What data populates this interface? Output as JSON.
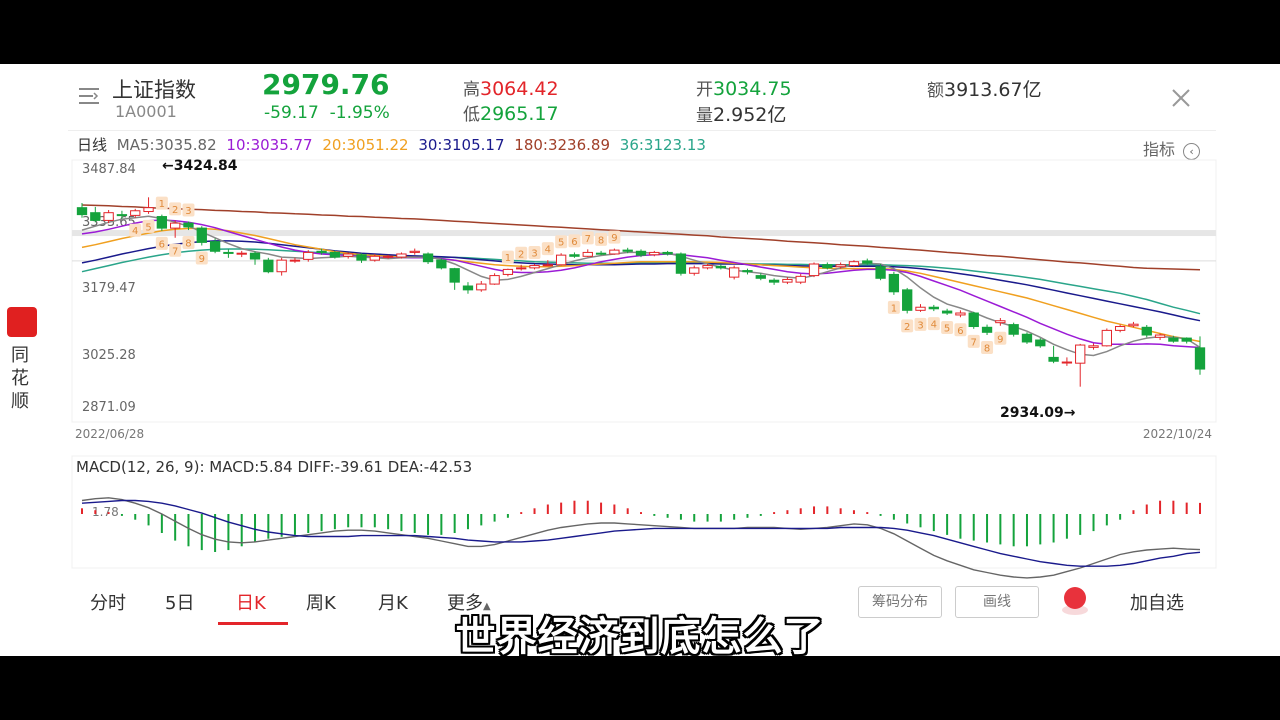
{
  "header": {
    "name": "上证指数",
    "code": "1A0001",
    "price": "2979.76",
    "change": "-59.17",
    "change_pct": "-1.95%",
    "high_label": "高",
    "high": "3064.42",
    "low_label": "低",
    "low": "2965.17",
    "open_label": "开",
    "open": "3034.75",
    "volume_label": "量",
    "volume": "2.952亿",
    "amount_label": "额",
    "amount": "3913.67亿"
  },
  "ma_row": {
    "period": "日线",
    "ma5": "MA5:3035.82",
    "ma10": "10:3035.77",
    "ma20": "20:3051.22",
    "ma30": "30:3105.17",
    "ma180": "180:3236.89",
    "ma36": "36:3123.13",
    "indicator_label": "指标"
  },
  "colors": {
    "up": "#e3252a",
    "down": "#14a33c",
    "ma5": "#888888",
    "ma10": "#9b1bd6",
    "ma20": "#f0a020",
    "ma30": "#1a1a8c",
    "ma180": "#a0402a",
    "ma36": "#2aa58a"
  },
  "price_axis": {
    "ticks": [
      "3487.84",
      "3333.65",
      "3179.47",
      "3025.28",
      "2871.09"
    ],
    "start_date": "2022/06/28",
    "end_date": "2022/10/24",
    "high_marker": "←3424.84",
    "low_marker": "2934.09→"
  },
  "macd": {
    "label": "MACD(12, 26, 9): MACD:5.84 DIFF:-39.61 DEA:-42.53",
    "tick": "1.78"
  },
  "sidebar": {
    "app_name": "同花顺"
  },
  "tabs": [
    "分时",
    "5日",
    "日K",
    "周K",
    "月K",
    "更多"
  ],
  "buttons": {
    "chips": "筹码分布",
    "draw": "画线",
    "add_fav": "加自选"
  },
  "subtitle": "世界经济到底怎么了",
  "chart_data": {
    "type": "candlestick",
    "title": "上证指数",
    "x_start": "2022/06/28",
    "x_end": "2022/10/24",
    "ylim": [
      2871.09,
      3487.84
    ],
    "y_ticks": [
      3487.84,
      3333.65,
      3179.47,
      3025.28,
      2871.09
    ],
    "annotations": [
      {
        "text": "←3424.84",
        "value": 3424.84
      },
      {
        "text": "2934.09→",
        "value": 2934.09
      }
    ],
    "candles": [
      [
        3398,
        3380,
        3410,
        3372
      ],
      [
        3385,
        3365,
        3400,
        3360
      ],
      [
        3365,
        3385,
        3392,
        3358
      ],
      [
        3380,
        3378,
        3390,
        3370
      ],
      [
        3378,
        3390,
        3395,
        3372
      ],
      [
        3388,
        3398,
        3424.84,
        3382
      ],
      [
        3375,
        3345,
        3380,
        3338
      ],
      [
        3345,
        3358,
        3365,
        3320
      ],
      [
        3358,
        3348,
        3362,
        3340
      ],
      [
        3345,
        3308,
        3350,
        3300
      ],
      [
        3310,
        3285,
        3318,
        3280
      ],
      [
        3282,
        3280,
        3290,
        3268
      ],
      [
        3280,
        3280,
        3286,
        3270
      ],
      [
        3280,
        3265,
        3285,
        3250
      ],
      [
        3262,
        3232,
        3268,
        3228
      ],
      [
        3232,
        3262,
        3268,
        3222
      ],
      [
        3262,
        3262,
        3268,
        3255
      ],
      [
        3264,
        3282,
        3288,
        3258
      ],
      [
        3285,
        3282,
        3292,
        3276
      ],
      [
        3282,
        3270,
        3286,
        3266
      ],
      [
        3272,
        3278,
        3282,
        3266
      ],
      [
        3276,
        3262,
        3280,
        3255
      ],
      [
        3262,
        3272,
        3278,
        3258
      ],
      [
        3272,
        3272,
        3276,
        3266
      ],
      [
        3270,
        3278,
        3282,
        3266
      ],
      [
        3282,
        3285,
        3292,
        3276
      ],
      [
        3278,
        3258,
        3282,
        3252
      ],
      [
        3262,
        3242,
        3266,
        3238
      ],
      [
        3240,
        3205,
        3242,
        3185
      ],
      [
        3195,
        3185,
        3205,
        3175
      ],
      [
        3185,
        3200,
        3208,
        3180
      ],
      [
        3200,
        3222,
        3228,
        3198
      ],
      [
        3225,
        3238,
        3240,
        3220
      ],
      [
        3240,
        3242,
        3250,
        3235
      ],
      [
        3242,
        3248,
        3252,
        3238
      ],
      [
        3250,
        3250,
        3262,
        3248
      ],
      [
        3250,
        3275,
        3280,
        3248
      ],
      [
        3276,
        3272,
        3282,
        3268
      ],
      [
        3272,
        3282,
        3290,
        3270
      ],
      [
        3280,
        3278,
        3286,
        3275
      ],
      [
        3278,
        3288,
        3292,
        3276
      ],
      [
        3288,
        3285,
        3294,
        3280
      ],
      [
        3285,
        3275,
        3290,
        3270
      ],
      [
        3276,
        3282,
        3286,
        3272
      ],
      [
        3282,
        3278,
        3286,
        3274
      ],
      [
        3278,
        3228,
        3282,
        3222
      ],
      [
        3228,
        3242,
        3248,
        3222
      ],
      [
        3242,
        3248,
        3252,
        3238
      ],
      [
        3246,
        3242,
        3250,
        3238
      ],
      [
        3218,
        3242,
        3248,
        3212
      ],
      [
        3235,
        3232,
        3240,
        3225
      ],
      [
        3222,
        3215,
        3228,
        3210
      ],
      [
        3210,
        3205,
        3215,
        3198
      ],
      [
        3205,
        3212,
        3218,
        3200
      ],
      [
        3205,
        3220,
        3226,
        3200
      ],
      [
        3222,
        3252,
        3256,
        3218
      ],
      [
        3250,
        3242,
        3256,
        3238
      ],
      [
        3245,
        3250,
        3256,
        3240
      ],
      [
        3248,
        3258,
        3262,
        3244
      ],
      [
        3260,
        3254,
        3266,
        3250
      ],
      [
        3245,
        3215,
        3252,
        3210
      ],
      [
        3225,
        3180,
        3232,
        3172
      ],
      [
        3185,
        3132,
        3190,
        3124
      ],
      [
        3132,
        3140,
        3148,
        3128
      ],
      [
        3140,
        3136,
        3146,
        3130
      ],
      [
        3130,
        3125,
        3136,
        3120
      ],
      [
        3120,
        3125,
        3132,
        3114
      ],
      [
        3125,
        3090,
        3128,
        3084
      ],
      [
        3088,
        3075,
        3095,
        3068
      ],
      [
        3100,
        3105,
        3112,
        3092
      ],
      [
        3095,
        3070,
        3100,
        3064
      ],
      [
        3070,
        3050,
        3075,
        3045
      ],
      [
        3055,
        3040,
        3060,
        3035
      ],
      [
        3010,
        3000,
        3040,
        2995
      ],
      [
        2996,
        2998,
        3010,
        2988
      ],
      [
        2995,
        3042,
        3045,
        2934.09
      ],
      [
        3036,
        3040,
        3046,
        3030
      ],
      [
        3040,
        3080,
        3085,
        3038
      ],
      [
        3080,
        3090,
        3095,
        3075
      ],
      [
        3092,
        3096,
        3102,
        3088
      ],
      [
        3088,
        3068,
        3094,
        3062
      ],
      [
        3062,
        3068,
        3072,
        3055
      ],
      [
        3060,
        3052,
        3066,
        3048
      ],
      [
        3060,
        3052,
        3062,
        3046
      ],
      [
        3034.75,
        2979.76,
        3064.42,
        2965.17
      ]
    ],
    "moving_averages": {
      "MA5": [
        3340,
        3350,
        3360,
        3368,
        3372,
        3376,
        3370,
        3360,
        3350,
        3335,
        3320,
        3305,
        3292,
        3284,
        3278,
        3270,
        3268,
        3266,
        3268,
        3270,
        3272,
        3270,
        3268,
        3266,
        3268,
        3270,
        3270,
        3264,
        3252,
        3236,
        3220,
        3210,
        3212,
        3220,
        3230,
        3240,
        3250,
        3260,
        3268,
        3274,
        3278,
        3282,
        3282,
        3280,
        3280,
        3272,
        3262,
        3252,
        3244,
        3236,
        3232,
        3228,
        3222,
        3218,
        3215,
        3222,
        3232,
        3242,
        3250,
        3254,
        3252,
        3240,
        3218,
        3190,
        3166,
        3148,
        3138,
        3126,
        3112,
        3100,
        3090,
        3078,
        3062,
        3044,
        3030,
        3018,
        3015,
        3025,
        3040,
        3052,
        3060,
        3064,
        3062,
        3058,
        3036
      ],
      "MA10": [
        3330,
        3335,
        3342,
        3350,
        3358,
        3364,
        3366,
        3364,
        3360,
        3354,
        3346,
        3336,
        3326,
        3316,
        3306,
        3296,
        3288,
        3282,
        3278,
        3276,
        3274,
        3272,
        3270,
        3268,
        3268,
        3268,
        3268,
        3266,
        3262,
        3254,
        3246,
        3238,
        3232,
        3230,
        3230,
        3232,
        3236,
        3242,
        3250,
        3258,
        3264,
        3270,
        3274,
        3276,
        3278,
        3276,
        3272,
        3268,
        3262,
        3256,
        3250,
        3244,
        3238,
        3232,
        3228,
        3226,
        3228,
        3232,
        3236,
        3238,
        3238,
        3236,
        3230,
        3220,
        3208,
        3196,
        3184,
        3170,
        3156,
        3142,
        3128,
        3114,
        3098,
        3084,
        3070,
        3058,
        3048,
        3044,
        3044,
        3044,
        3045,
        3044,
        3040,
        3038,
        3035.77
      ],
      "MA20": [
        3295,
        3302,
        3310,
        3318,
        3325,
        3332,
        3338,
        3342,
        3344,
        3344,
        3342,
        3338,
        3332,
        3326,
        3318,
        3310,
        3302,
        3296,
        3290,
        3284,
        3280,
        3276,
        3274,
        3272,
        3270,
        3270,
        3268,
        3266,
        3262,
        3258,
        3254,
        3250,
        3248,
        3246,
        3245,
        3245,
        3246,
        3248,
        3250,
        3252,
        3254,
        3256,
        3258,
        3258,
        3258,
        3258,
        3258,
        3257,
        3256,
        3254,
        3252,
        3250,
        3248,
        3246,
        3244,
        3242,
        3241,
        3240,
        3240,
        3240,
        3240,
        3238,
        3234,
        3228,
        3220,
        3212,
        3204,
        3196,
        3188,
        3180,
        3172,
        3164,
        3154,
        3144,
        3134,
        3124,
        3114,
        3104,
        3096,
        3088,
        3080,
        3072,
        3064,
        3058,
        3051.22
      ],
      "MA30": [
        3255,
        3262,
        3270,
        3278,
        3285,
        3292,
        3298,
        3303,
        3307,
        3310,
        3312,
        3312,
        3311,
        3309,
        3306,
        3302,
        3298,
        3294,
        3290,
        3286,
        3283,
        3280,
        3278,
        3276,
        3274,
        3273,
        3272,
        3271,
        3269,
        3266,
        3263,
        3260,
        3257,
        3255,
        3253,
        3252,
        3251,
        3250,
        3250,
        3250,
        3250,
        3251,
        3252,
        3252,
        3253,
        3253,
        3253,
        3253,
        3252,
        3252,
        3251,
        3250,
        3249,
        3248,
        3247,
        3246,
        3246,
        3246,
        3246,
        3246,
        3246,
        3245,
        3243,
        3240,
        3236,
        3232,
        3227,
        3222,
        3216,
        3210,
        3204,
        3198,
        3191,
        3184,
        3177,
        3170,
        3163,
        3156,
        3149,
        3142,
        3135,
        3128,
        3120,
        3112,
        3105.17
      ],
      "MA180": [
        3405,
        3404,
        3403,
        3401,
        3400,
        3398,
        3397,
        3395,
        3394,
        3393,
        3391,
        3390,
        3388,
        3387,
        3385,
        3384,
        3382,
        3381,
        3379,
        3378,
        3376,
        3375,
        3373,
        3372,
        3370,
        3369,
        3367,
        3365,
        3363,
        3361,
        3359,
        3357,
        3355,
        3353,
        3351,
        3349,
        3347,
        3345,
        3343,
        3341,
        3339,
        3337,
        3335,
        3333,
        3331,
        3329,
        3327,
        3325,
        3322,
        3320,
        3318,
        3316,
        3314,
        3311,
        3309,
        3307,
        3305,
        3302,
        3300,
        3298,
        3295,
        3293,
        3290,
        3288,
        3285,
        3282,
        3280,
        3277,
        3274,
        3272,
        3269,
        3266,
        3263,
        3260,
        3257,
        3255,
        3252,
        3249,
        3246,
        3243,
        3241,
        3240,
        3239,
        3238,
        3236.89
      ],
      "MA36": [
        3232,
        3240,
        3248,
        3256,
        3263,
        3270,
        3276,
        3281,
        3285,
        3288,
        3290,
        3291,
        3291,
        3290,
        3289,
        3287,
        3285,
        3283,
        3281,
        3279,
        3277,
        3275,
        3274,
        3273,
        3272,
        3271,
        3271,
        3270,
        3269,
        3268,
        3266,
        3264,
        3262,
        3260,
        3258,
        3257,
        3256,
        3255,
        3254,
        3254,
        3254,
        3254,
        3254,
        3254,
        3254,
        3254,
        3254,
        3254,
        3254,
        3253,
        3253,
        3252,
        3252,
        3251,
        3251,
        3250,
        3250,
        3250,
        3250,
        3250,
        3250,
        3249,
        3248,
        3246,
        3244,
        3241,
        3238,
        3234,
        3230,
        3226,
        3222,
        3217,
        3212,
        3206,
        3200,
        3194,
        3188,
        3182,
        3176,
        3168,
        3160,
        3150,
        3140,
        3132,
        3123.13
      ]
    },
    "td_labels_red": [
      {
        "i": 4,
        "t": "4"
      },
      {
        "i": 5,
        "t": "5"
      },
      {
        "i": 6,
        "t": "6"
      },
      {
        "i": 7,
        "t": "7"
      },
      {
        "i": 8,
        "t": "8"
      },
      {
        "i": 9,
        "t": "9"
      },
      {
        "i": 61,
        "t": "1"
      },
      {
        "i": 62,
        "t": "2"
      },
      {
        "i": 63,
        "t": "3"
      },
      {
        "i": 64,
        "t": "4"
      },
      {
        "i": 65,
        "t": "5"
      },
      {
        "i": 66,
        "t": "6"
      },
      {
        "i": 67,
        "t": "7"
      },
      {
        "i": 68,
        "t": "8"
      },
      {
        "i": 69,
        "t": "9"
      }
    ],
    "td_labels_green": [
      {
        "i": 6,
        "t": "1"
      },
      {
        "i": 7,
        "t": "2"
      },
      {
        "i": 8,
        "t": "3"
      },
      {
        "i": 32,
        "t": "1"
      },
      {
        "i": 33,
        "t": "2"
      },
      {
        "i": 34,
        "t": "3"
      },
      {
        "i": 35,
        "t": "4"
      },
      {
        "i": 36,
        "t": "5"
      },
      {
        "i": 37,
        "t": "6"
      },
      {
        "i": 38,
        "t": "7"
      },
      {
        "i": 39,
        "t": "8"
      },
      {
        "i": 40,
        "t": "9"
      }
    ],
    "macd_hist": [
      3,
      2,
      1,
      -1,
      -3,
      -6,
      -10,
      -14,
      -17,
      -19,
      -20,
      -19,
      -17,
      -15,
      -13,
      -12,
      -11,
      -10,
      -9,
      -8,
      -7,
      -7,
      -7,
      -8,
      -9,
      -10,
      -11,
      -11,
      -10,
      -8,
      -6,
      -4,
      -2,
      1,
      3,
      5,
      6,
      7,
      7,
      6,
      5,
      3,
      1,
      -1,
      -2,
      -3,
      -4,
      -4,
      -4,
      -3,
      -2,
      -1,
      1,
      2,
      3,
      4,
      4,
      3,
      2,
      1,
      -1,
      -3,
      -5,
      -7,
      -9,
      -11,
      -13,
      -14,
      -15,
      -16,
      -17,
      -17,
      -16,
      -15,
      -13,
      -11,
      -9,
      -6,
      -3,
      2,
      5,
      7,
      7,
      6,
      5.84
    ],
    "diff": [
      15,
      17,
      18,
      16,
      12,
      7,
      0,
      -8,
      -16,
      -23,
      -28,
      -31,
      -32,
      -31,
      -29,
      -27,
      -25,
      -23,
      -21,
      -19,
      -18,
      -18,
      -19,
      -21,
      -23,
      -25,
      -27,
      -30,
      -33,
      -36,
      -36,
      -34,
      -30,
      -26,
      -22,
      -18,
      -15,
      -13,
      -11,
      -10,
      -10,
      -11,
      -12,
      -13,
      -14,
      -15,
      -16,
      -16,
      -16,
      -16,
      -15,
      -15,
      -15,
      -16,
      -17,
      -16,
      -15,
      -13,
      -11,
      -12,
      -16,
      -22,
      -30,
      -38,
      -46,
      -52,
      -57,
      -62,
      -65,
      -68,
      -70,
      -71,
      -70,
      -68,
      -64,
      -60,
      -55,
      -50,
      -45,
      -42,
      -40,
      -39,
      -38,
      -39,
      -39.61
    ],
    "dea": [
      12,
      13,
      14,
      15,
      15,
      14,
      12,
      9,
      5,
      1,
      -4,
      -9,
      -13,
      -17,
      -20,
      -22,
      -24,
      -25,
      -25,
      -25,
      -25,
      -24,
      -24,
      -24,
      -24,
      -24,
      -25,
      -26,
      -27,
      -29,
      -30,
      -31,
      -31,
      -31,
      -30,
      -29,
      -27,
      -25,
      -23,
      -21,
      -19,
      -18,
      -17,
      -16,
      -16,
      -16,
      -16,
      -16,
      -16,
      -16,
      -16,
      -16,
      -16,
      -16,
      -16,
      -16,
      -16,
      -15,
      -15,
      -15,
      -15,
      -16,
      -18,
      -21,
      -24,
      -28,
      -32,
      -36,
      -40,
      -44,
      -47,
      -50,
      -53,
      -55,
      -57,
      -58,
      -58,
      -58,
      -57,
      -55,
      -52,
      -49,
      -47,
      -44,
      -42.53
    ]
  }
}
